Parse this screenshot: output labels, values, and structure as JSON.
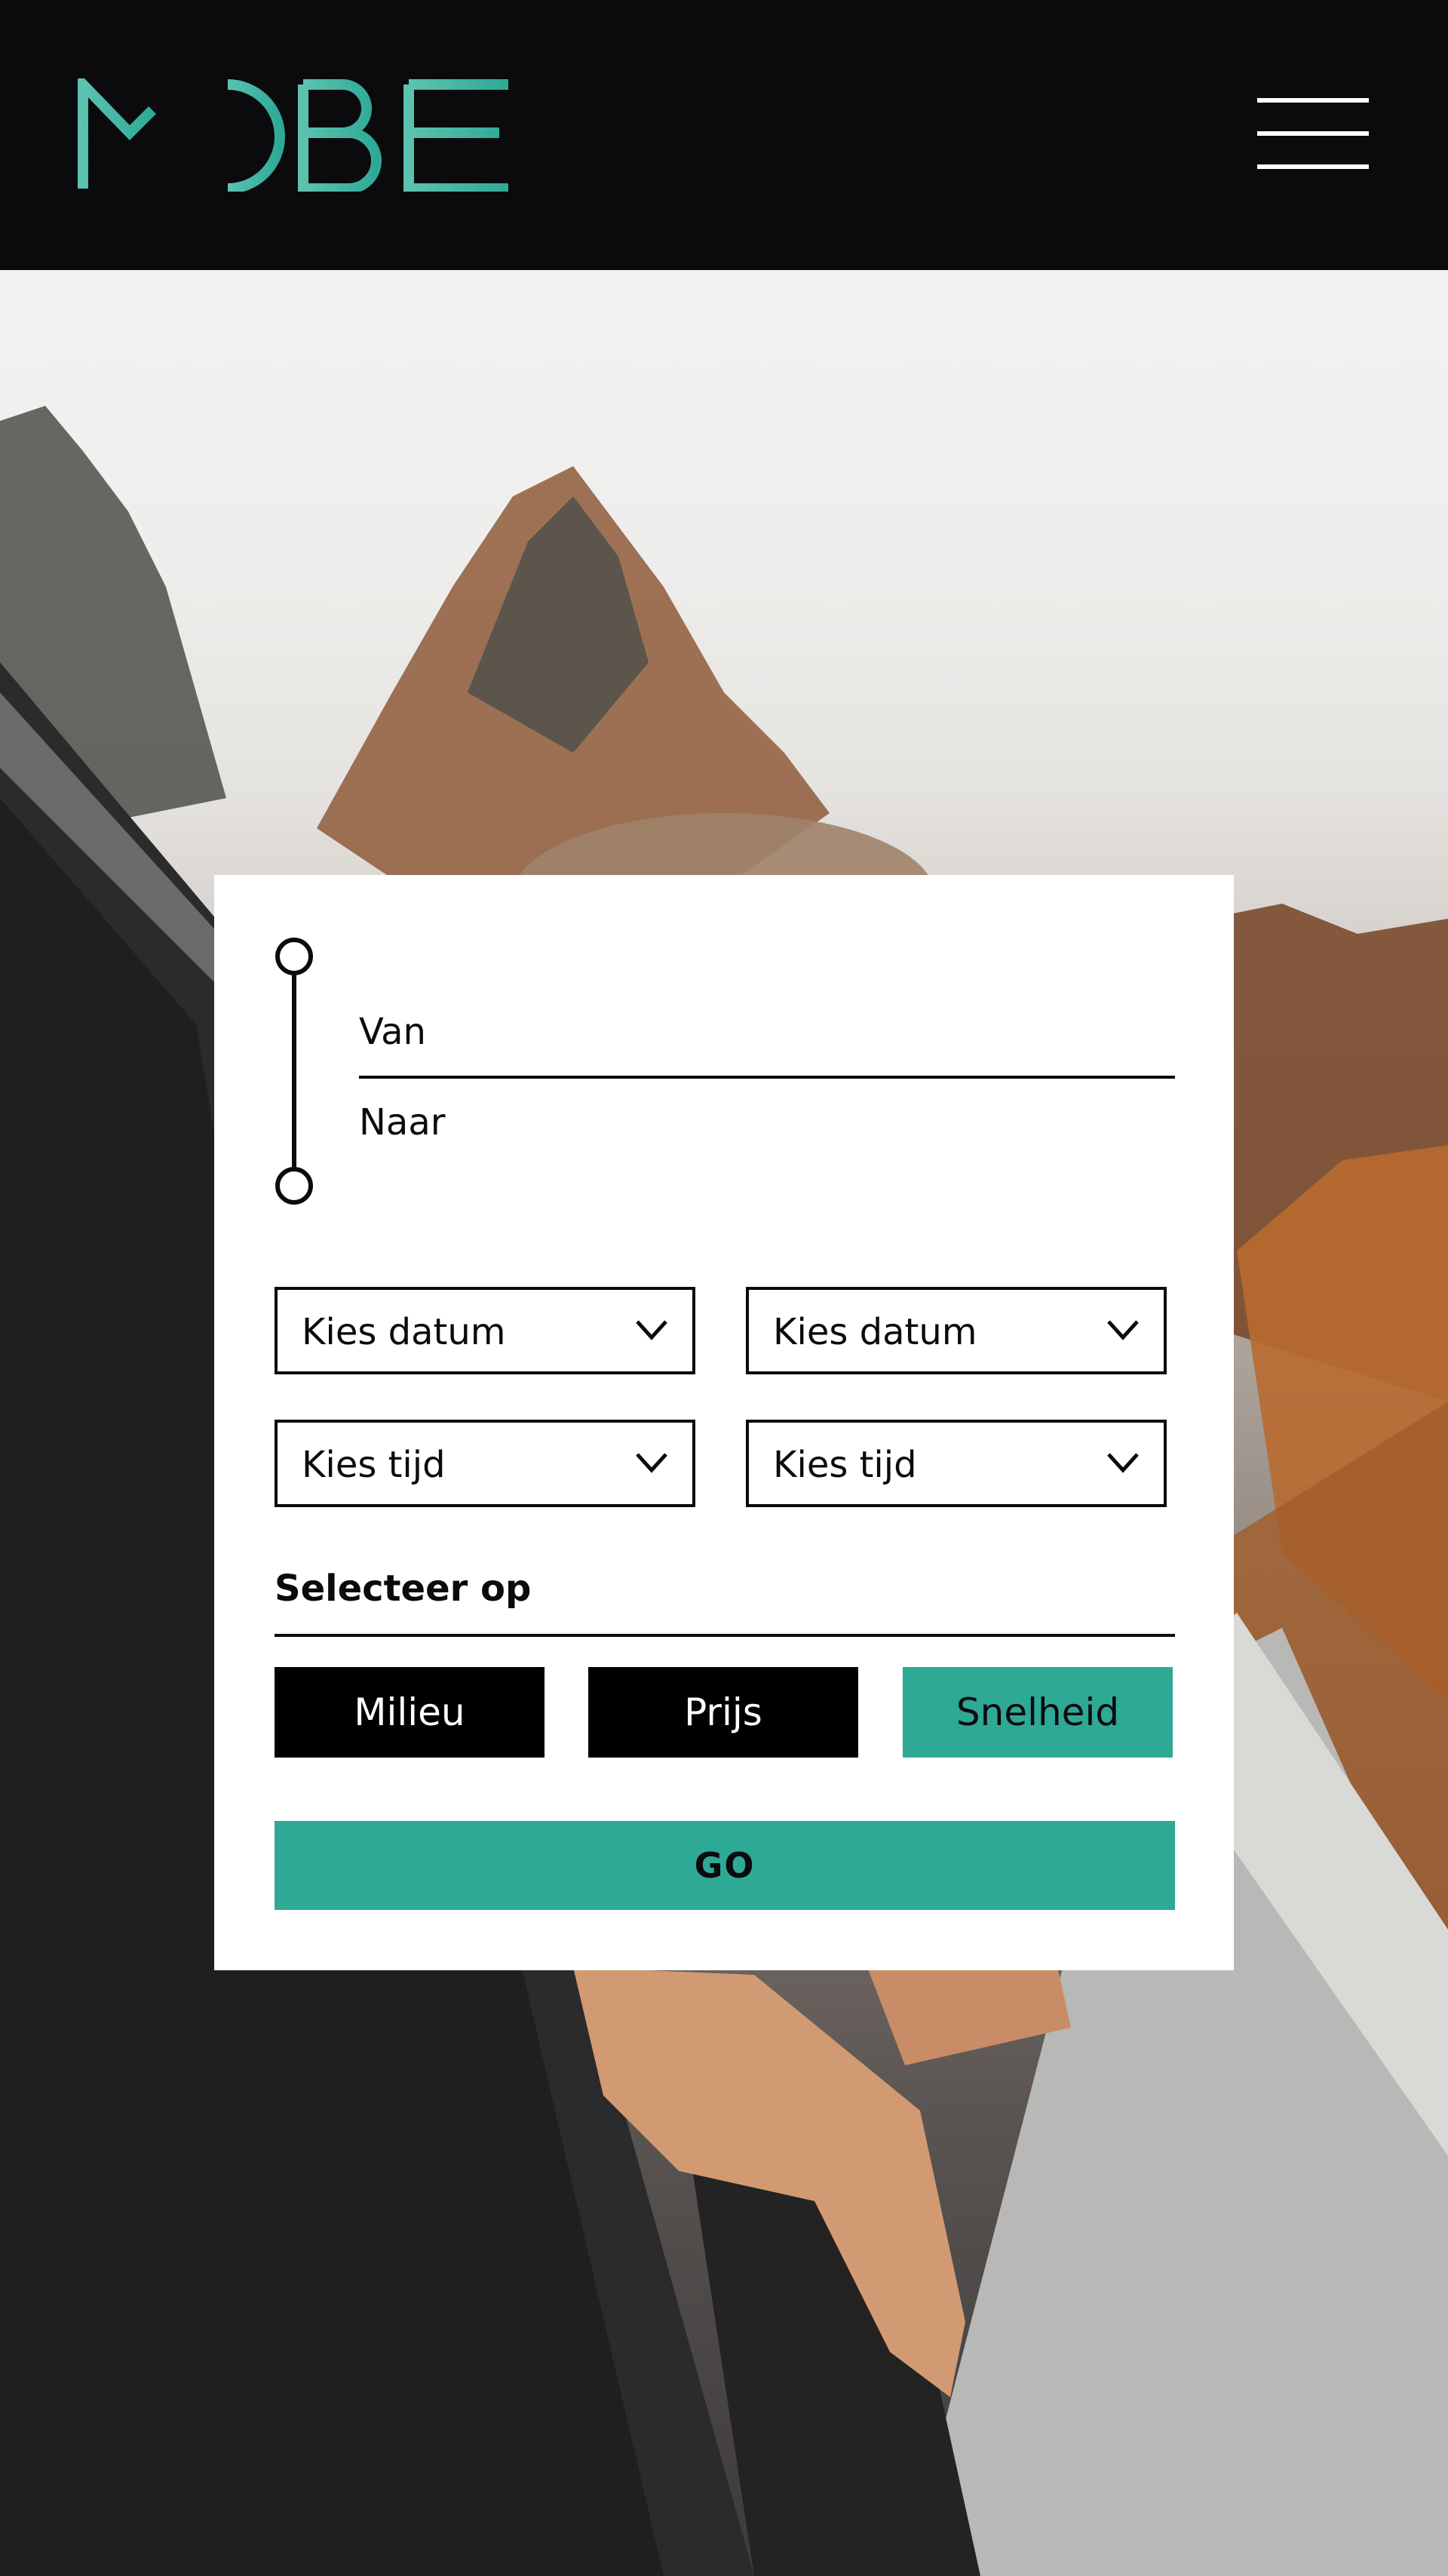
{
  "brand": {
    "logo_text": "MOBE",
    "accent_color": "#2ea996",
    "header_bg": "#0b0b0d"
  },
  "header": {
    "menu_icon": "hamburger-menu-icon"
  },
  "route": {
    "from_label": "Van",
    "to_label": "Naar",
    "icon": "route-line-icon"
  },
  "selects": {
    "date_from": "Kies datum",
    "date_to": "Kies datum",
    "time_from": "Kies tijd",
    "time_to": "Kies tijd",
    "chevron_icon": "chevron-down-icon"
  },
  "filter": {
    "heading": "Selecteer op",
    "options": [
      "Milieu",
      "Prijs",
      "Snelheid"
    ],
    "active": "Snelheid"
  },
  "submit": {
    "label": "GO"
  }
}
